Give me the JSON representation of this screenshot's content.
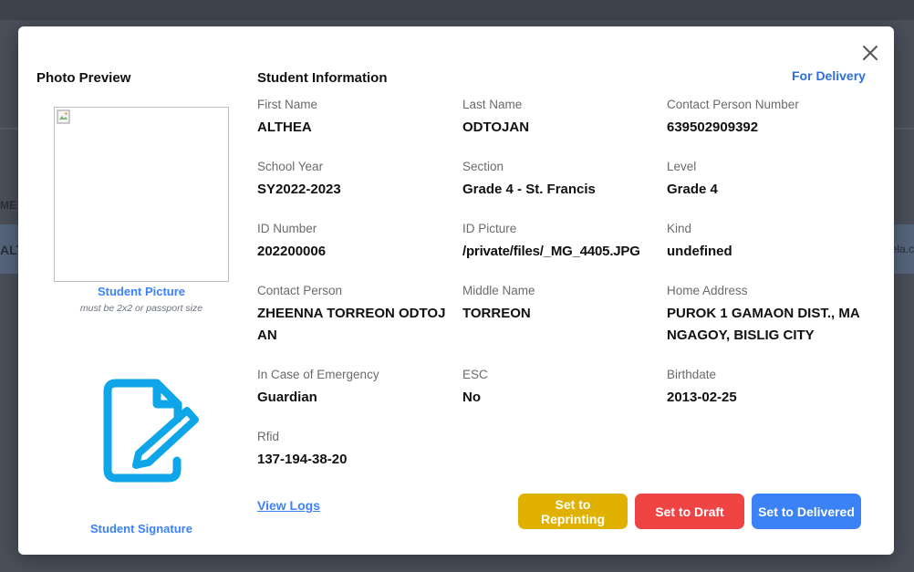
{
  "background": {
    "left_header_fragment": "ME",
    "left_row_fragment": "ALT",
    "right_row_fragment": "ela.c"
  },
  "modal": {
    "status": "For Delivery",
    "photo_heading": "Photo Preview",
    "student_picture_label": "Student Picture",
    "picture_note": "must be 2x2 or passport size",
    "student_signature_label": "Student Signature",
    "info_heading": "Student Information",
    "fields": {
      "first_name": {
        "label": "First Name",
        "value": "ALTHEA"
      },
      "last_name": {
        "label": "Last Name",
        "value": "ODTOJAN"
      },
      "contact_person_number": {
        "label": "Contact Person Number",
        "value": "639502909392"
      },
      "school_year": {
        "label": "School Year",
        "value": "SY2022-2023"
      },
      "section": {
        "label": "Section",
        "value": "Grade 4 - St. Francis"
      },
      "level": {
        "label": "Level",
        "value": "Grade 4"
      },
      "id_number": {
        "label": "ID Number",
        "value": "202200006"
      },
      "id_picture": {
        "label": "ID Picture",
        "value": "/private/files/_MG_4405.JPG"
      },
      "kind": {
        "label": "Kind",
        "value": "undefined"
      },
      "contact_person": {
        "label": "Contact Person",
        "value": "ZHEENNA TORREON ODTOJAN"
      },
      "middle_name": {
        "label": "Middle Name",
        "value": "TORREON"
      },
      "home_address": {
        "label": "Home Address",
        "value": "PUROK 1 GAMAON DIST., MANGAGOY, BISLIG CITY"
      },
      "in_case_of_emergency": {
        "label": "In Case of Emergency",
        "value": "Guardian"
      },
      "esc": {
        "label": "ESC",
        "value": "No"
      },
      "birthdate": {
        "label": "Birthdate",
        "value": "2013-02-25"
      },
      "rfid": {
        "label": "Rfid",
        "value": "137-194-38-20"
      }
    },
    "view_logs": "View Logs",
    "buttons": {
      "reprinting": "Set to Reprinting",
      "draft": "Set to Draft",
      "delivered": "Set to Delivered"
    },
    "icons": {
      "close": "close-icon",
      "signature": "signature-icon",
      "broken_image": "broken-image-icon"
    },
    "colors": {
      "accent_blue": "#3b82f6",
      "reprint_yellow": "#e0b100",
      "draft_red": "#ef4444",
      "signature_cyan": "#0ea5e9"
    }
  }
}
